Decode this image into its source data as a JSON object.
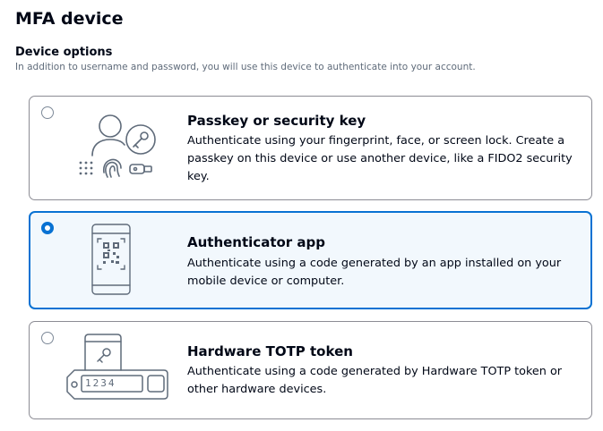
{
  "page": {
    "title": "MFA device"
  },
  "device_options": {
    "label": "Device options",
    "description": "In addition to username and password, you will use this device to authenticate into your account."
  },
  "options": [
    {
      "title": "Passkey or security key",
      "description": "Authenticate using your fingerprint, face, or screen lock. Create a passkey on this device or use another device, like a FIDO2 security key.",
      "selected": false,
      "illustration": "person-key-fingerprint-icon"
    },
    {
      "title": "Authenticator app",
      "description": "Authenticate using a code generated by an app installed on your mobile device or computer.",
      "selected": true,
      "illustration": "phone-qr-code-icon"
    },
    {
      "title": "Hardware TOTP token",
      "description": "Authenticate using a code generated by Hardware TOTP token or other hardware devices.",
      "selected": false,
      "illustration": "phone-hardware-token-icon",
      "token_display": "1234"
    }
  ],
  "colors": {
    "accent": "#0972d3",
    "selected_bg": "#f2f8fd",
    "border": "#8c8c94",
    "illustration": "#5f6b7a"
  }
}
